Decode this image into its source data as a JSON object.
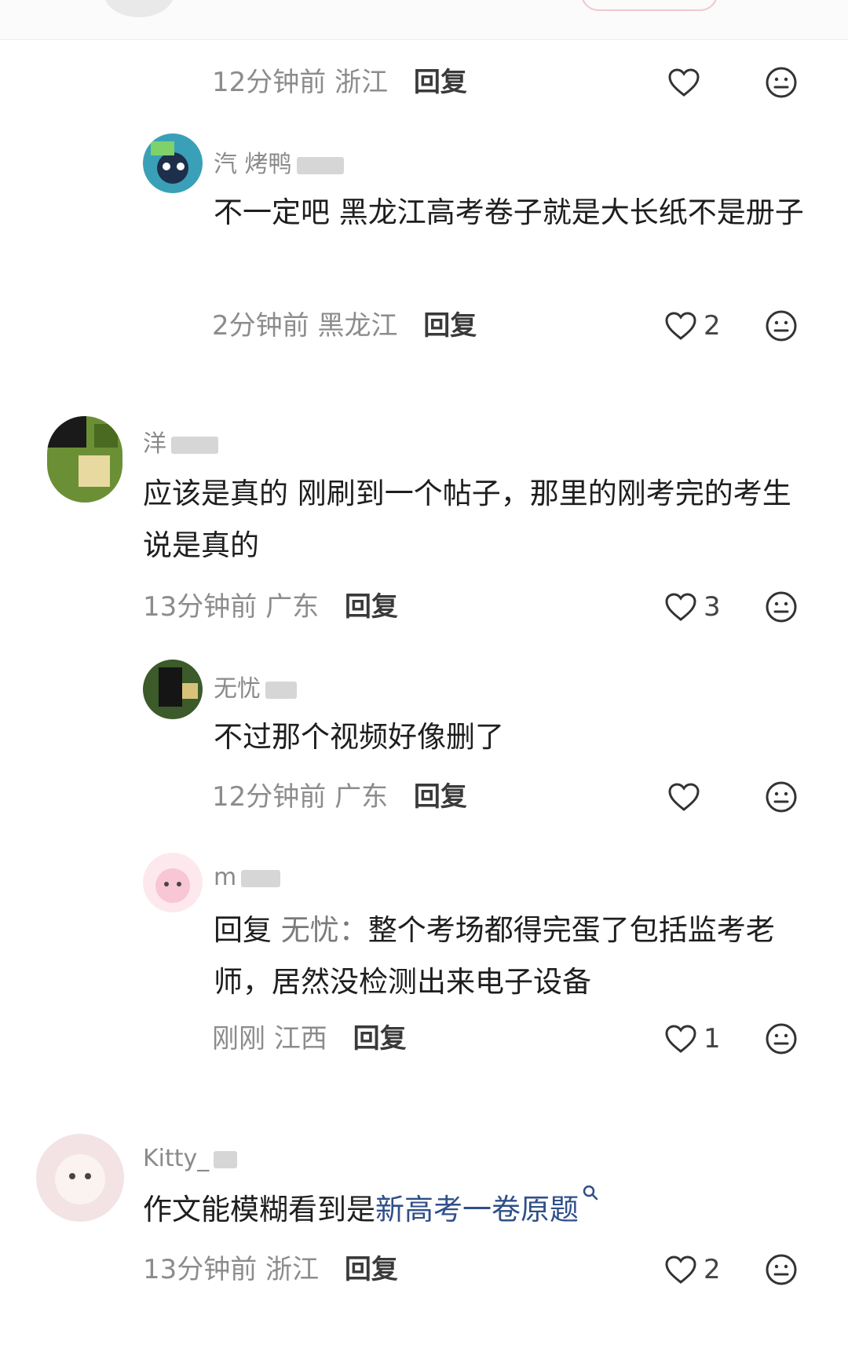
{
  "comments": [
    {
      "id": "c1",
      "level": "reply",
      "username": "",
      "text": "",
      "time": "12分钟前",
      "region": "浙江",
      "reply_label": "回复",
      "likes": ""
    },
    {
      "id": "c2",
      "level": "reply",
      "username": "汽 烤鸭",
      "text": "不一定吧 黑龙江高考卷子就是大长纸不是册子",
      "time": "2分钟前",
      "region": "黑龙江",
      "reply_label": "回复",
      "likes": "2"
    },
    {
      "id": "c3",
      "level": "top",
      "username": "洋",
      "text": "应该是真的 刚刷到一个帖子，那里的刚考完的考生说是真的",
      "time": "13分钟前",
      "region": "广东",
      "reply_label": "回复",
      "likes": "3"
    },
    {
      "id": "c4",
      "level": "reply",
      "username": "无忧",
      "text": "不过那个视频好像删了",
      "time": "12分钟前",
      "region": "广东",
      "reply_label": "回复",
      "likes": ""
    },
    {
      "id": "c5",
      "level": "reply",
      "username": "m",
      "reply_prefix": "回复",
      "reply_to": "无忧：",
      "text": "整个考场都得完蛋了包括监考老师，居然没检测出来电子设备",
      "time": "刚刚",
      "region": "江西",
      "reply_label": "回复",
      "likes": "1"
    },
    {
      "id": "c6",
      "level": "top",
      "username": "Kitty_",
      "text": "作文能模糊看到是",
      "link_text": "新高考一卷原题",
      "time": "13分钟前",
      "region": "浙江",
      "reply_label": "回复",
      "likes": "2"
    }
  ],
  "icons": {
    "like": "heart-outline-icon",
    "emoji": "neutral-face-icon",
    "search": "search-icon"
  },
  "colors": {
    "link": "#2f4f88",
    "meta": "#8c8c8c"
  }
}
